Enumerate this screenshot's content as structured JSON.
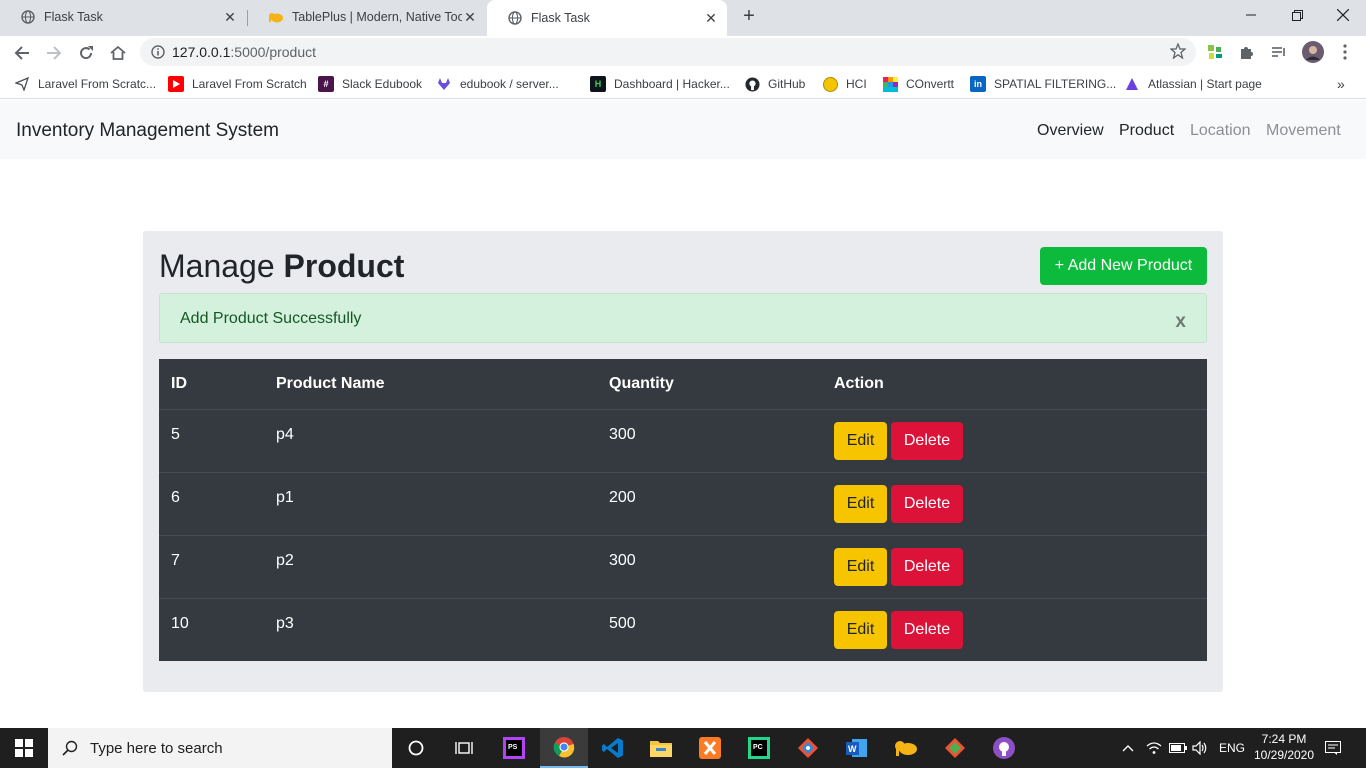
{
  "browser": {
    "tabs": [
      {
        "title": "Flask Task",
        "active": false
      },
      {
        "title": "TablePlus | Modern, Native Tool f",
        "active": false
      },
      {
        "title": "Flask Task",
        "active": true
      }
    ],
    "url_host": "127.0.0.1",
    "url_path": ":5000/product",
    "bookmarks": [
      {
        "label": "Laravel From Scratc...",
        "icon": "paper-plane-icon"
      },
      {
        "label": "Laravel From Scratch",
        "icon": "youtube-icon"
      },
      {
        "label": "Slack Edubook",
        "icon": "slack-icon"
      },
      {
        "label": "edubook / server...",
        "icon": "gitlab-icon"
      },
      {
        "label": "Dashboard | Hacker...",
        "icon": "hackerrank-icon"
      },
      {
        "label": "GitHub",
        "icon": "github-icon"
      },
      {
        "label": "HCI",
        "icon": "hci-icon"
      },
      {
        "label": "COnvertt",
        "icon": "convertt-icon"
      },
      {
        "label": "SPATIAL FILTERING...",
        "icon": "linkedin-icon"
      },
      {
        "label": "Atlassian | Start page",
        "icon": "atlassian-icon"
      }
    ]
  },
  "navbar": {
    "brand": "Inventory Management System",
    "links": [
      {
        "label": "Overview",
        "state": "dark"
      },
      {
        "label": "Product",
        "state": "dark"
      },
      {
        "label": "Location",
        "state": "muted"
      },
      {
        "label": "Movement",
        "state": "muted"
      }
    ]
  },
  "page": {
    "heading_prefix": "Manage",
    "heading_bold": "Product",
    "add_button": "+ Add New Product",
    "alert_message": "Add Product Successfully",
    "alert_close": "x"
  },
  "table": {
    "headers": [
      "ID",
      "Product Name",
      "Quantity",
      "Action"
    ],
    "rows": [
      {
        "id": "5",
        "name": "p4",
        "quantity": "300"
      },
      {
        "id": "6",
        "name": "p1",
        "quantity": "200"
      },
      {
        "id": "7",
        "name": "p2",
        "quantity": "300"
      },
      {
        "id": "10",
        "name": "p3",
        "quantity": "500"
      }
    ],
    "edit_label": "Edit",
    "delete_label": "Delete"
  },
  "taskbar": {
    "search_placeholder": "Type here to search",
    "language": "ENG",
    "time": "7:24 PM",
    "date": "10/29/2020"
  },
  "colors": {
    "success_button": "#0cba3c",
    "alert_bg": "#d3f1dc",
    "table_bg": "#343a40",
    "edit_button": "#f7c400",
    "delete_button": "#dc1238"
  }
}
